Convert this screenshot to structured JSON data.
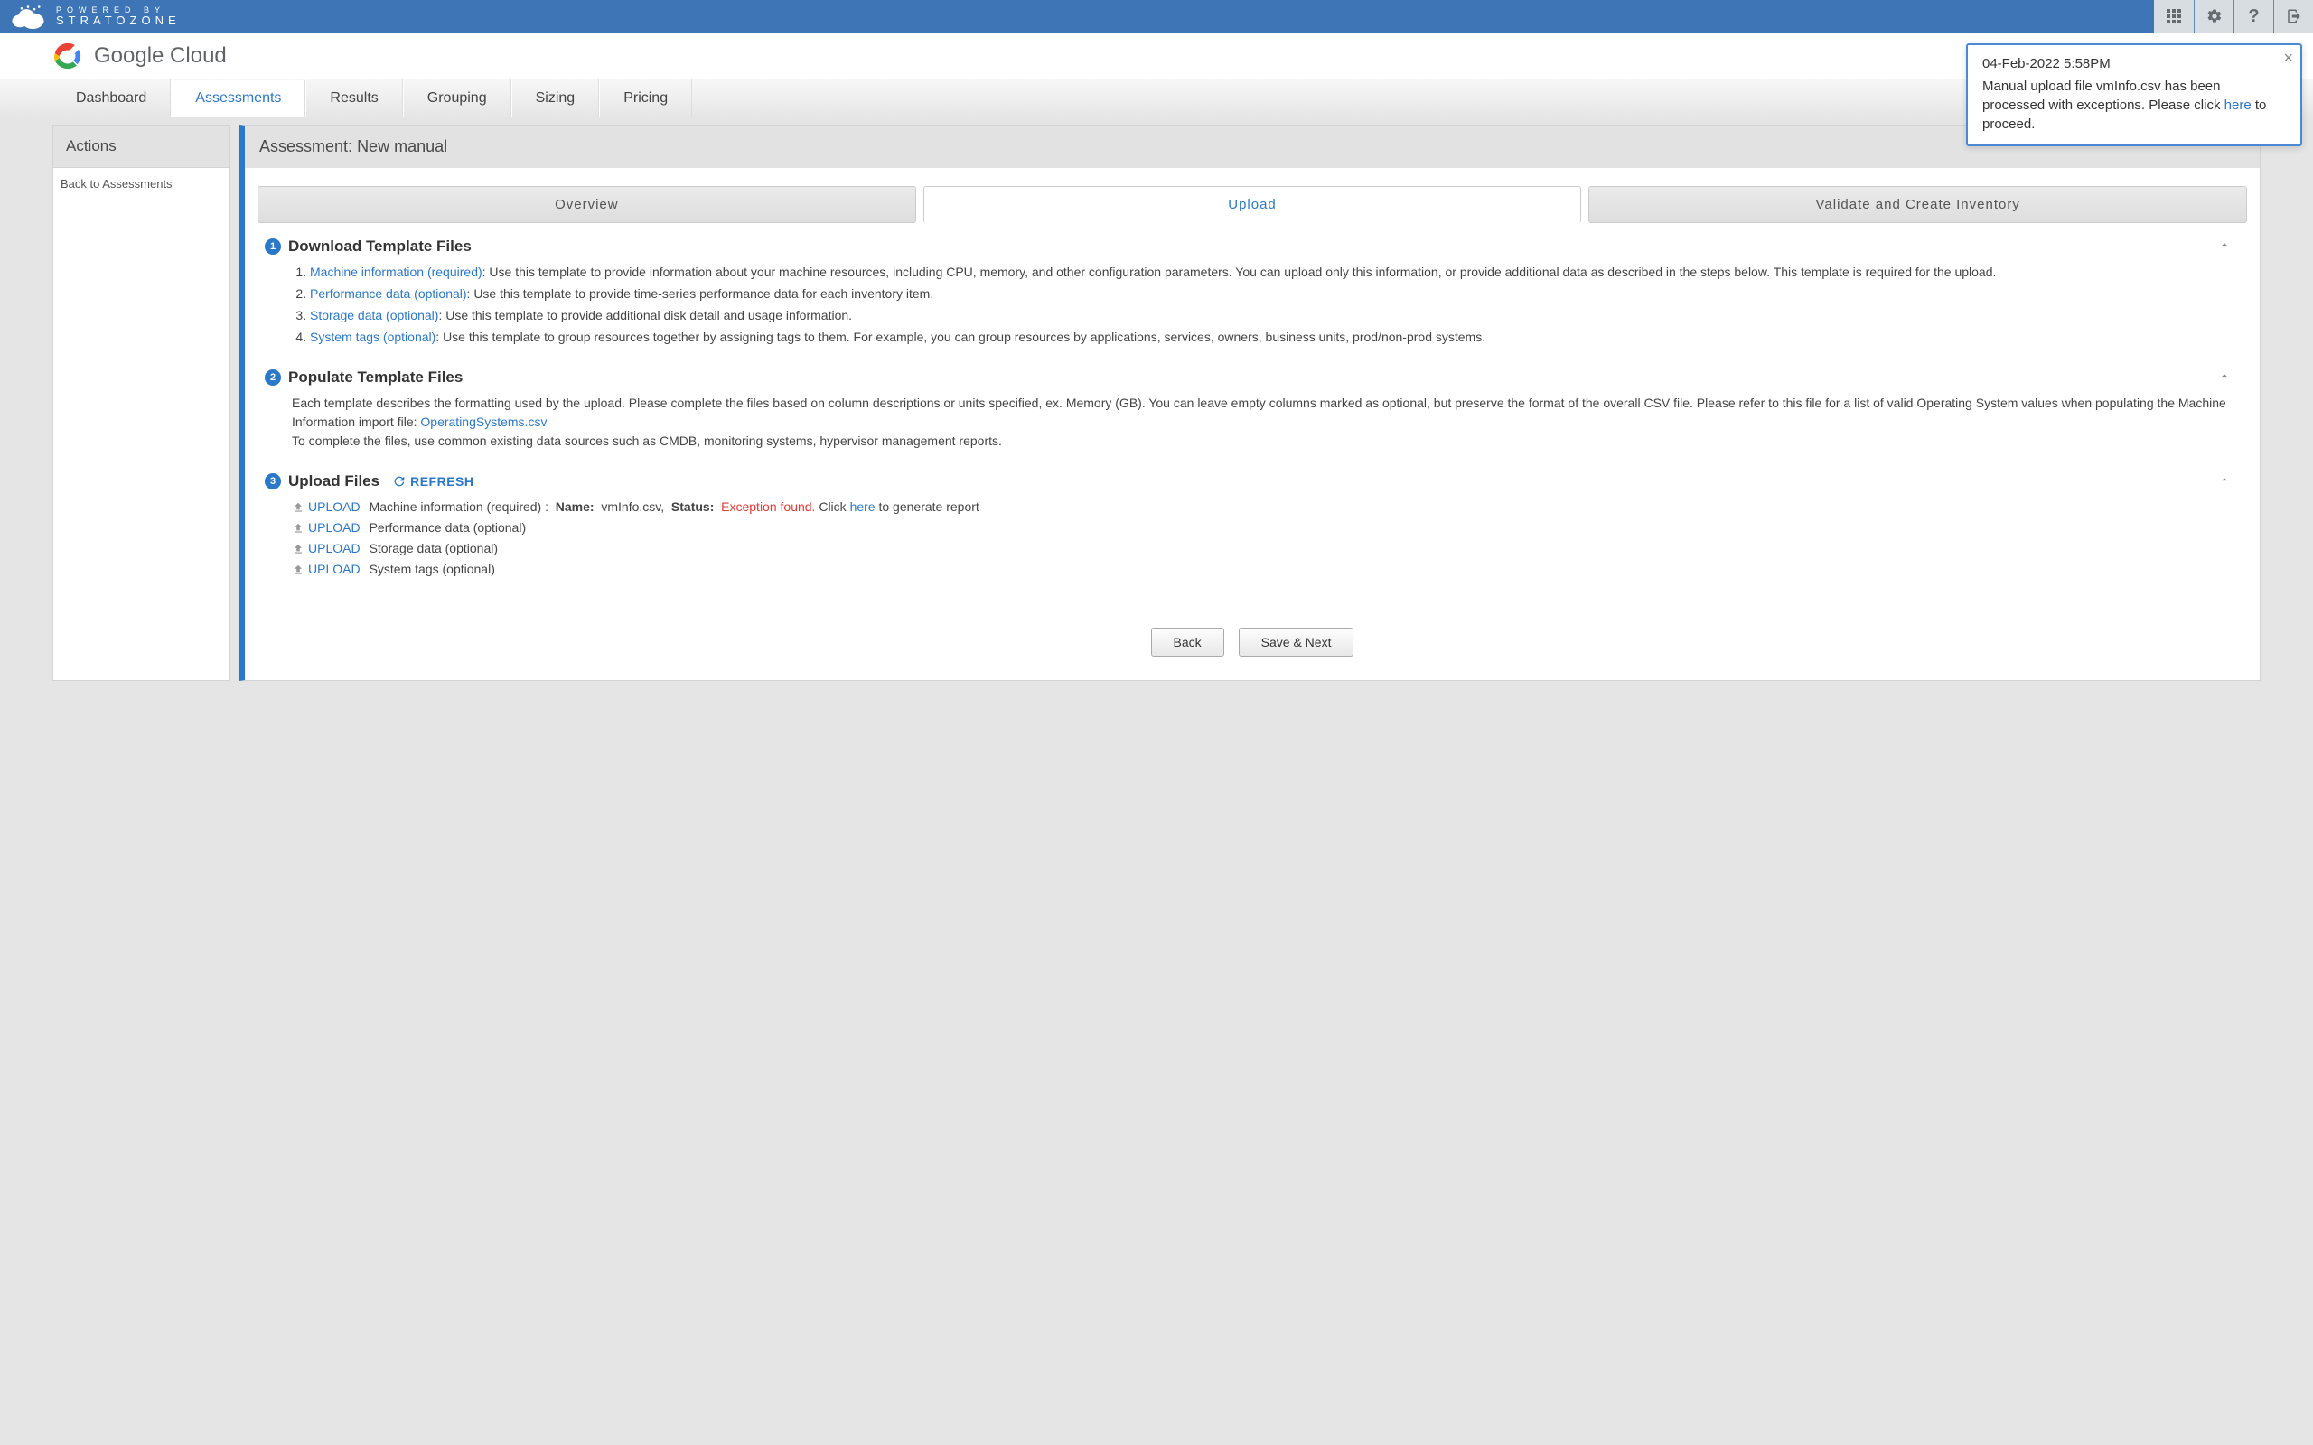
{
  "topbar": {
    "powered": "POWERED BY",
    "brand": "STRATOZONE"
  },
  "gc": {
    "google": "Google",
    "cloud": " Cloud"
  },
  "nav": {
    "items": [
      {
        "label": "Dashboard",
        "active": false
      },
      {
        "label": "Assessments",
        "active": true
      },
      {
        "label": "Results",
        "active": false
      },
      {
        "label": "Grouping",
        "active": false
      },
      {
        "label": "Sizing",
        "active": false
      },
      {
        "label": "Pricing",
        "active": false
      }
    ]
  },
  "sidebar": {
    "title": "Actions",
    "back": "Back to Assessments"
  },
  "panel": {
    "title_prefix": "Assessment:",
    "title_name": "New manual"
  },
  "subtabs": [
    {
      "label": "Overview",
      "active": false
    },
    {
      "label": "Upload",
      "active": true
    },
    {
      "label": "Validate and Create Inventory",
      "active": false
    }
  ],
  "step1": {
    "title": "Download Template Files",
    "items": [
      {
        "link": "Machine information (required)",
        "text": ": Use this template to provide information about your machine resources, including CPU, memory, and other configuration parameters. You can upload only this information, or provide additional data as described in the steps below. This template is required for the upload."
      },
      {
        "link": "Performance data (optional)",
        "text": ": Use this template to provide time-series performance data for each inventory item."
      },
      {
        "link": "Storage data (optional)",
        "text": ": Use this template to provide additional disk detail and usage information."
      },
      {
        "link": "System tags (optional)",
        "text": ": Use this template to group resources together by assigning tags to them. For example, you can group resources by applications, services, owners, business units, prod/non-prod systems."
      }
    ]
  },
  "step2": {
    "title": "Populate Template Files",
    "text1": "Each template describes the formatting used by the upload. Please complete the files based on column descriptions or units specified, ex. Memory (GB). You can leave empty columns marked as optional, but preserve the format of the overall CSV file. Please refer to this file for a list of valid Operating System values when populating the Machine Information import file: ",
    "link": "OperatingSystems.csv",
    "text2": "To complete the files, use common existing data sources such as CMDB, monitoring systems, hypervisor management reports."
  },
  "step3": {
    "title": "Upload Files",
    "refresh": "REFRESH",
    "upload_label": "UPLOAD",
    "rows": {
      "r0_label": "Machine information (required) :",
      "r0_name_label": "Name:",
      "r0_name": "vmInfo.csv,",
      "r0_status_label": "Status:",
      "r0_status": "Exception found.",
      "r0_click": "Click ",
      "r0_here": "here",
      "r0_rest": " to generate report",
      "r1": "Performance data (optional)",
      "r2": "Storage data (optional)",
      "r3": "System tags (optional)"
    }
  },
  "buttons": {
    "back": "Back",
    "save_next": "Save & Next"
  },
  "toast": {
    "time": "04-Feb-2022 5:58PM",
    "msg1": "Manual upload file vmInfo.csv has been processed with exceptions. Please click ",
    "here": "here",
    "msg2": " to proceed."
  }
}
